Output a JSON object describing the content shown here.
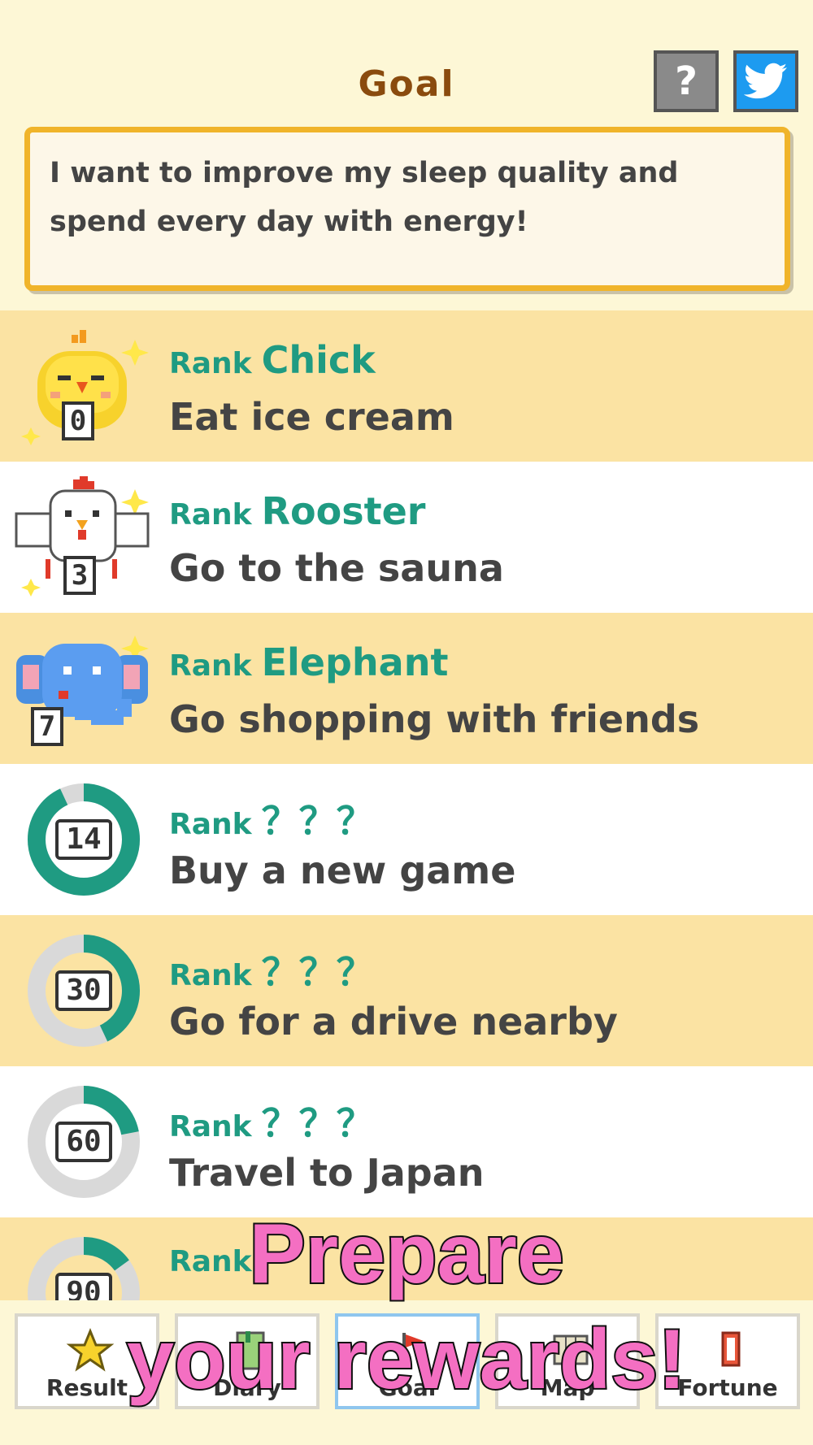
{
  "header": {
    "title": "Goal",
    "help_label": "?",
    "help_icon": "question-icon",
    "share_icon": "twitter-bird-icon"
  },
  "goal": {
    "text": "I want to improve my sleep quality and spend every day with energy!"
  },
  "rewards": [
    {
      "rank_label": "Rank",
      "rank_name": "Chick",
      "reward": "Eat ice cream",
      "days": "0",
      "icon": "chick-icon",
      "unlocked": true
    },
    {
      "rank_label": "Rank",
      "rank_name": "Rooster",
      "reward": "Go to the sauna",
      "days": "3",
      "icon": "rooster-icon",
      "unlocked": true
    },
    {
      "rank_label": "Rank",
      "rank_name": "Elephant",
      "reward": "Go shopping with friends",
      "days": "7",
      "icon": "elephant-icon",
      "unlocked": true
    },
    {
      "rank_label": "Rank",
      "rank_name": "？？？",
      "reward": "Buy a new game",
      "days": "14",
      "icon": "progress-ring-icon",
      "unlocked": false,
      "progress": 0.93
    },
    {
      "rank_label": "Rank",
      "rank_name": "？？？",
      "reward": "Go for a drive nearby",
      "days": "30",
      "icon": "progress-ring-icon",
      "unlocked": false,
      "progress": 0.43
    },
    {
      "rank_label": "Rank",
      "rank_name": "？？？",
      "reward": "Travel to Japan",
      "days": "60",
      "icon": "progress-ring-icon",
      "unlocked": false,
      "progress": 0.22
    },
    {
      "rank_label": "Rank",
      "rank_name": "",
      "reward": "",
      "days": "90",
      "icon": "progress-ring-icon",
      "unlocked": false,
      "progress": 0.15
    }
  ],
  "nav": {
    "items": [
      {
        "label": "Result",
        "icon": "star-icon"
      },
      {
        "label": "Diary",
        "icon": "diary-icon"
      },
      {
        "label": "Goal",
        "icon": "flag-icon"
      },
      {
        "label": "Map",
        "icon": "map-icon"
      },
      {
        "label": "Fortune",
        "icon": "fortune-slip-icon"
      }
    ],
    "active": "Goal"
  },
  "promo": {
    "line1": "Prepare",
    "line2": "your rewards!"
  },
  "colors": {
    "background": "#fdf7d6",
    "row_alt": "#fbe3a3",
    "rank_teal": "#1f9b82",
    "title_brown": "#8a4b0e",
    "goal_border": "#f0b42a",
    "promo_pink": "#f46fc2",
    "ring_track": "#d9d9d9",
    "ring_fill": "#1f9b82"
  }
}
